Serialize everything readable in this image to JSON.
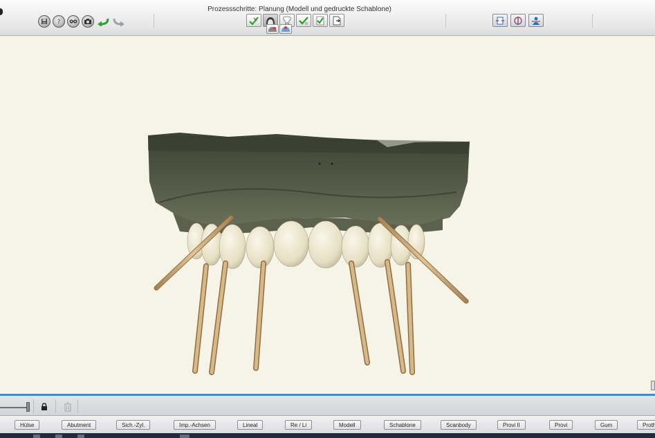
{
  "toolbar": {
    "process_steps_title": "Prozessschritte: Planung (Modell und gedruckte Schablone)",
    "left_buttons": [
      {
        "icon": "save-icon"
      },
      {
        "icon": "help-icon"
      },
      {
        "icon": "glasses-icon"
      },
      {
        "icon": "camera-icon"
      },
      {
        "icon": "undo-arrow-icon",
        "color": "#2f9e2f"
      },
      {
        "icon": "redo-arrow-icon",
        "color": "#9aa0a6"
      }
    ],
    "step_buttons": [
      {
        "icon": "scan-step-icon"
      },
      {
        "icon": "planning-step-icon"
      },
      {
        "icon": "tooth-step-icon"
      },
      {
        "icon": "check-step-icon"
      },
      {
        "icon": "check-done-step-icon"
      },
      {
        "icon": "export-step-icon"
      }
    ],
    "sub_buttons": [
      {
        "icon": "model-plan-icon"
      },
      {
        "icon": "printed-guide-icon"
      }
    ],
    "view_buttons": [
      {
        "icon": "view-front-icon"
      },
      {
        "icon": "view-rotate-icon"
      },
      {
        "icon": "view-person-icon"
      }
    ]
  },
  "viewport": {
    "background": "#f6f4e6",
    "model_color": "#4a4f3e",
    "teeth_color": "#ede6cc",
    "sleeve_color": "#cba777"
  },
  "bottom_toolbar": {
    "icons": [
      "slider-icon",
      "lock-icon",
      "trash-icon"
    ]
  },
  "component_buttons": [
    "Hülse",
    "Abutment",
    "Sich.-Zyl.",
    "Imp.-Achsen",
    "Lineal",
    "Re / Li",
    "Modell",
    "Schablone",
    "Scanbody",
    "Provi II",
    "Provi",
    "Gum",
    "Proth"
  ]
}
